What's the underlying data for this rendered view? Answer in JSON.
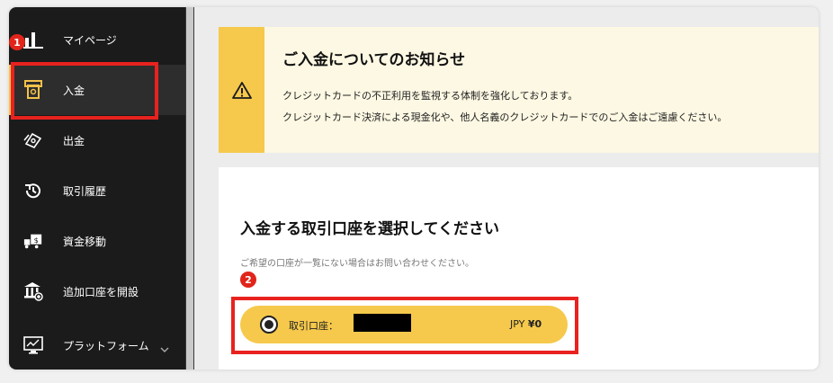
{
  "sidebar": {
    "items": [
      {
        "label": "マイページ",
        "icon": "bar-chart-icon"
      },
      {
        "label": "入金",
        "icon": "atm-deposit-icon"
      },
      {
        "label": "出金",
        "icon": "cash-withdraw-icon"
      },
      {
        "label": "取引履歴",
        "icon": "history-icon"
      },
      {
        "label": "資金移動",
        "icon": "truck-transfer-icon"
      },
      {
        "label": "追加口座を開設",
        "icon": "bank-add-icon"
      },
      {
        "label": "プラットフォーム",
        "icon": "monitor-chart-icon"
      }
    ]
  },
  "annotations": {
    "step1": "1",
    "step2": "2"
  },
  "notice": {
    "title": "ご入金についてのお知らせ",
    "line1": "クレジットカードの不正利用を監視する体制を強化しております。",
    "line2": "クレジットカード決済による現金化や、他人名義のクレジットカードでのご入金はご遠慮ください。"
  },
  "account_select": {
    "title": "入金する取引口座を選択してください",
    "subtitle": "ご希望の口座が一覧にない場合はお問い合わせください。",
    "account_label": "取引口座：",
    "currency": "JPY",
    "balance": "¥0"
  },
  "colors": {
    "accent": "#f6c94c",
    "sidebar_bg": "#1b1b1b",
    "highlight": "#e8221f"
  }
}
